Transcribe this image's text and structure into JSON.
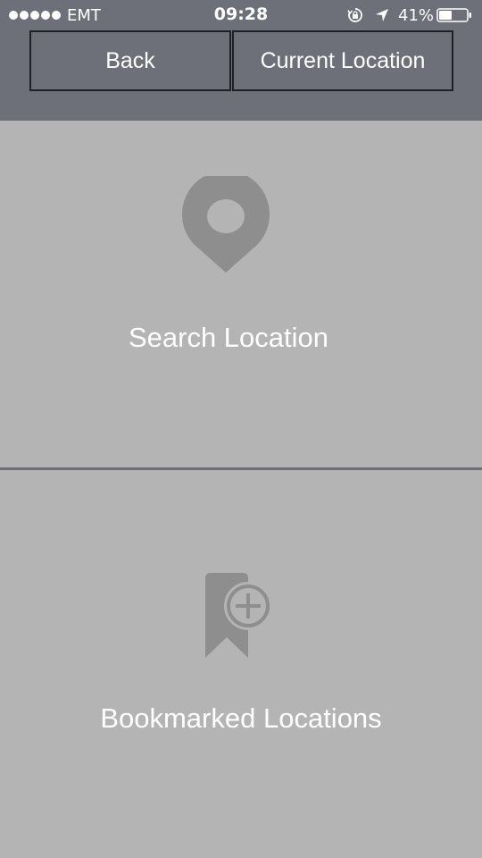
{
  "status_bar": {
    "carrier": "EMT",
    "time": "09:28",
    "battery": "41%",
    "icons": [
      "signal-dots",
      "rotation-lock-icon",
      "location-arrow-icon",
      "battery-icon"
    ]
  },
  "header": {
    "back_label": "Back",
    "current_location_label": "Current Location"
  },
  "options": {
    "search": {
      "label": "Search Location",
      "icon": "map-pin-icon"
    },
    "bookmarks": {
      "label": "Bookmarked Locations",
      "icon": "bookmark-add-icon"
    }
  },
  "colors": {
    "header_bg": "#6d7079",
    "panel_bg": "#b4b4b4",
    "icon_gray": "#8e8e8e",
    "text": "#ffffff"
  }
}
